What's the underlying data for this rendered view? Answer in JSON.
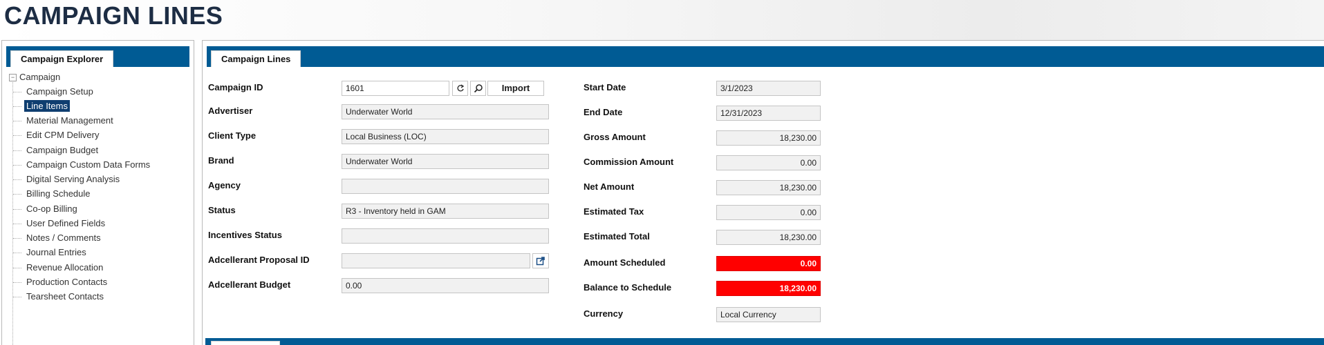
{
  "page": {
    "title": "CAMPAIGN LINES"
  },
  "explorer": {
    "tab_label": "Campaign Explorer",
    "root_label": "Campaign",
    "root_toggle": "−",
    "items": [
      {
        "label": "Campaign Setup"
      },
      {
        "label": "Line Items",
        "selected": true
      },
      {
        "label": "Material Management"
      },
      {
        "label": "Edit CPM Delivery"
      },
      {
        "label": "Campaign Budget"
      },
      {
        "label": "Campaign Custom Data Forms"
      },
      {
        "label": "Digital Serving Analysis"
      },
      {
        "label": "Billing Schedule"
      },
      {
        "label": "Co-op Billing"
      },
      {
        "label": "User Defined Fields"
      },
      {
        "label": "Notes / Comments"
      },
      {
        "label": "Journal Entries"
      },
      {
        "label": "Revenue Allocation"
      },
      {
        "label": "Production Contacts"
      },
      {
        "label": "Tearsheet Contacts"
      }
    ]
  },
  "campaign_lines": {
    "tab_label": "Campaign Lines",
    "left_fields": {
      "campaign_id": {
        "label": "Campaign ID",
        "value": "1601"
      },
      "advertiser": {
        "label": "Advertiser",
        "value": "Underwater World"
      },
      "client_type": {
        "label": "Client Type",
        "value": "Local Business (LOC)"
      },
      "brand": {
        "label": "Brand",
        "value": "Underwater World"
      },
      "agency": {
        "label": "Agency",
        "value": ""
      },
      "status": {
        "label": "Status",
        "value": "R3 - Inventory held in GAM"
      },
      "incentives_status": {
        "label": "Incentives Status",
        "value": ""
      },
      "adcellerant_proposal_id": {
        "label": "Adcellerant Proposal ID",
        "value": ""
      },
      "adcellerant_budget": {
        "label": "Adcellerant Budget",
        "value": "0.00"
      }
    },
    "import_label": "Import",
    "right_fields": {
      "start_date": {
        "label": "Start Date",
        "value": "3/1/2023"
      },
      "end_date": {
        "label": "End Date",
        "value": "12/31/2023"
      },
      "gross_amount": {
        "label": "Gross Amount",
        "value": "18,230.00"
      },
      "commission_amount": {
        "label": "Commission Amount",
        "value": "0.00"
      },
      "net_amount": {
        "label": "Net Amount",
        "value": "18,230.00"
      },
      "estimated_tax": {
        "label": "Estimated Tax",
        "value": "0.00"
      },
      "estimated_total": {
        "label": "Estimated Total",
        "value": "18,230.00"
      },
      "amount_scheduled": {
        "label": "Amount Scheduled",
        "value": "0.00"
      },
      "balance_to_schedule": {
        "label": "Balance to Schedule",
        "value": "18,230.00"
      },
      "currency": {
        "label": "Currency",
        "value": "Local Currency"
      }
    }
  },
  "colors": {
    "tabbar": "#005b94",
    "alert": "#ff0000",
    "selected": "#0f3e70",
    "title": "#1d2d44"
  },
  "icons": [
    "refresh-icon",
    "search-icon",
    "external-link-icon"
  ]
}
